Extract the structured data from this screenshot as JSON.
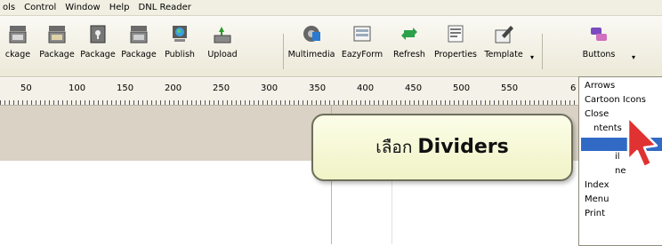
{
  "menu": [
    "ols",
    "Control",
    "Window",
    "Help",
    "DNL Reader"
  ],
  "toolbar": {
    "buttons": [
      {
        "label": "ckage",
        "icon": "package-icon"
      },
      {
        "label": "Package",
        "icon": "package-icon"
      },
      {
        "label": "Package",
        "icon": "lock-package-icon"
      },
      {
        "label": "Package",
        "icon": "package-icon"
      },
      {
        "label": "Publish",
        "icon": "publish-icon"
      },
      {
        "label": "Upload",
        "icon": "upload-icon"
      },
      {
        "label": "Multimedia",
        "icon": "multimedia-icon"
      },
      {
        "label": "EazyForm",
        "icon": "form-icon"
      },
      {
        "label": "Refresh",
        "icon": "refresh-icon"
      },
      {
        "label": "Properties",
        "icon": "properties-icon"
      },
      {
        "label": "Template",
        "icon": "template-icon"
      },
      {
        "label": "Buttons",
        "icon": "buttons-icon"
      }
    ]
  },
  "ruler": {
    "labels": [
      "50",
      "100",
      "150",
      "200",
      "250",
      "300",
      "350",
      "400",
      "450",
      "500",
      "550",
      "6"
    ]
  },
  "dropdown": {
    "items": [
      "Arrows",
      "Cartoon Icons",
      "Close",
      "ntents",
      "",
      "il",
      "ne",
      "Index",
      "Menu",
      "Print"
    ],
    "selected_index": 4
  },
  "callout": {
    "prefix": "เลือก",
    "bold": "Dividers"
  },
  "colors": {
    "selection": "#316ac5",
    "callout_bg": "#f5f7d2",
    "canvas_grey": "#d9d2c5"
  }
}
